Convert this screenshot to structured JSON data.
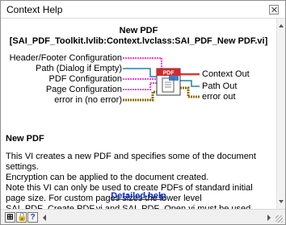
{
  "window": {
    "title": "Context Help",
    "close_icon": "close-icon"
  },
  "header": {
    "name": "New PDF",
    "path": "[SAI_PDF_Toolkit.lvlib:Context.lvclass:SAI_PDF_New PDF.vi]"
  },
  "connectors": {
    "inputs": [
      "Header/Footer Configuration",
      "Path (Dialog if Empty)",
      "PDF Configuration",
      "Page Configuration",
      "error in (no error)"
    ],
    "outputs": [
      "Context Out",
      "Path Out",
      "error out"
    ],
    "icon_label": "PDF",
    "wire_colors": {
      "pink": "#ff3fd6",
      "red": "#e03a2a",
      "teal": "#2f7f9a",
      "error": "#8a6a00"
    }
  },
  "description": {
    "title": "New PDF",
    "lines": [
      "This VI creates a new PDF and specifies some of the document settings.",
      "Encryption can be applied to the document created.",
      "Note this VI can only be used to create PDFs of standard initial page size. For custom pages sizes the lower level SAI_PDF_Create PDF.vi and SAI_PDF_Open.vi must be used."
    ],
    "link": "Detailed help"
  },
  "bottombar": {
    "buttons": [
      "pin-icon",
      "lock-icon",
      "help-icon"
    ],
    "help_label": "?"
  }
}
